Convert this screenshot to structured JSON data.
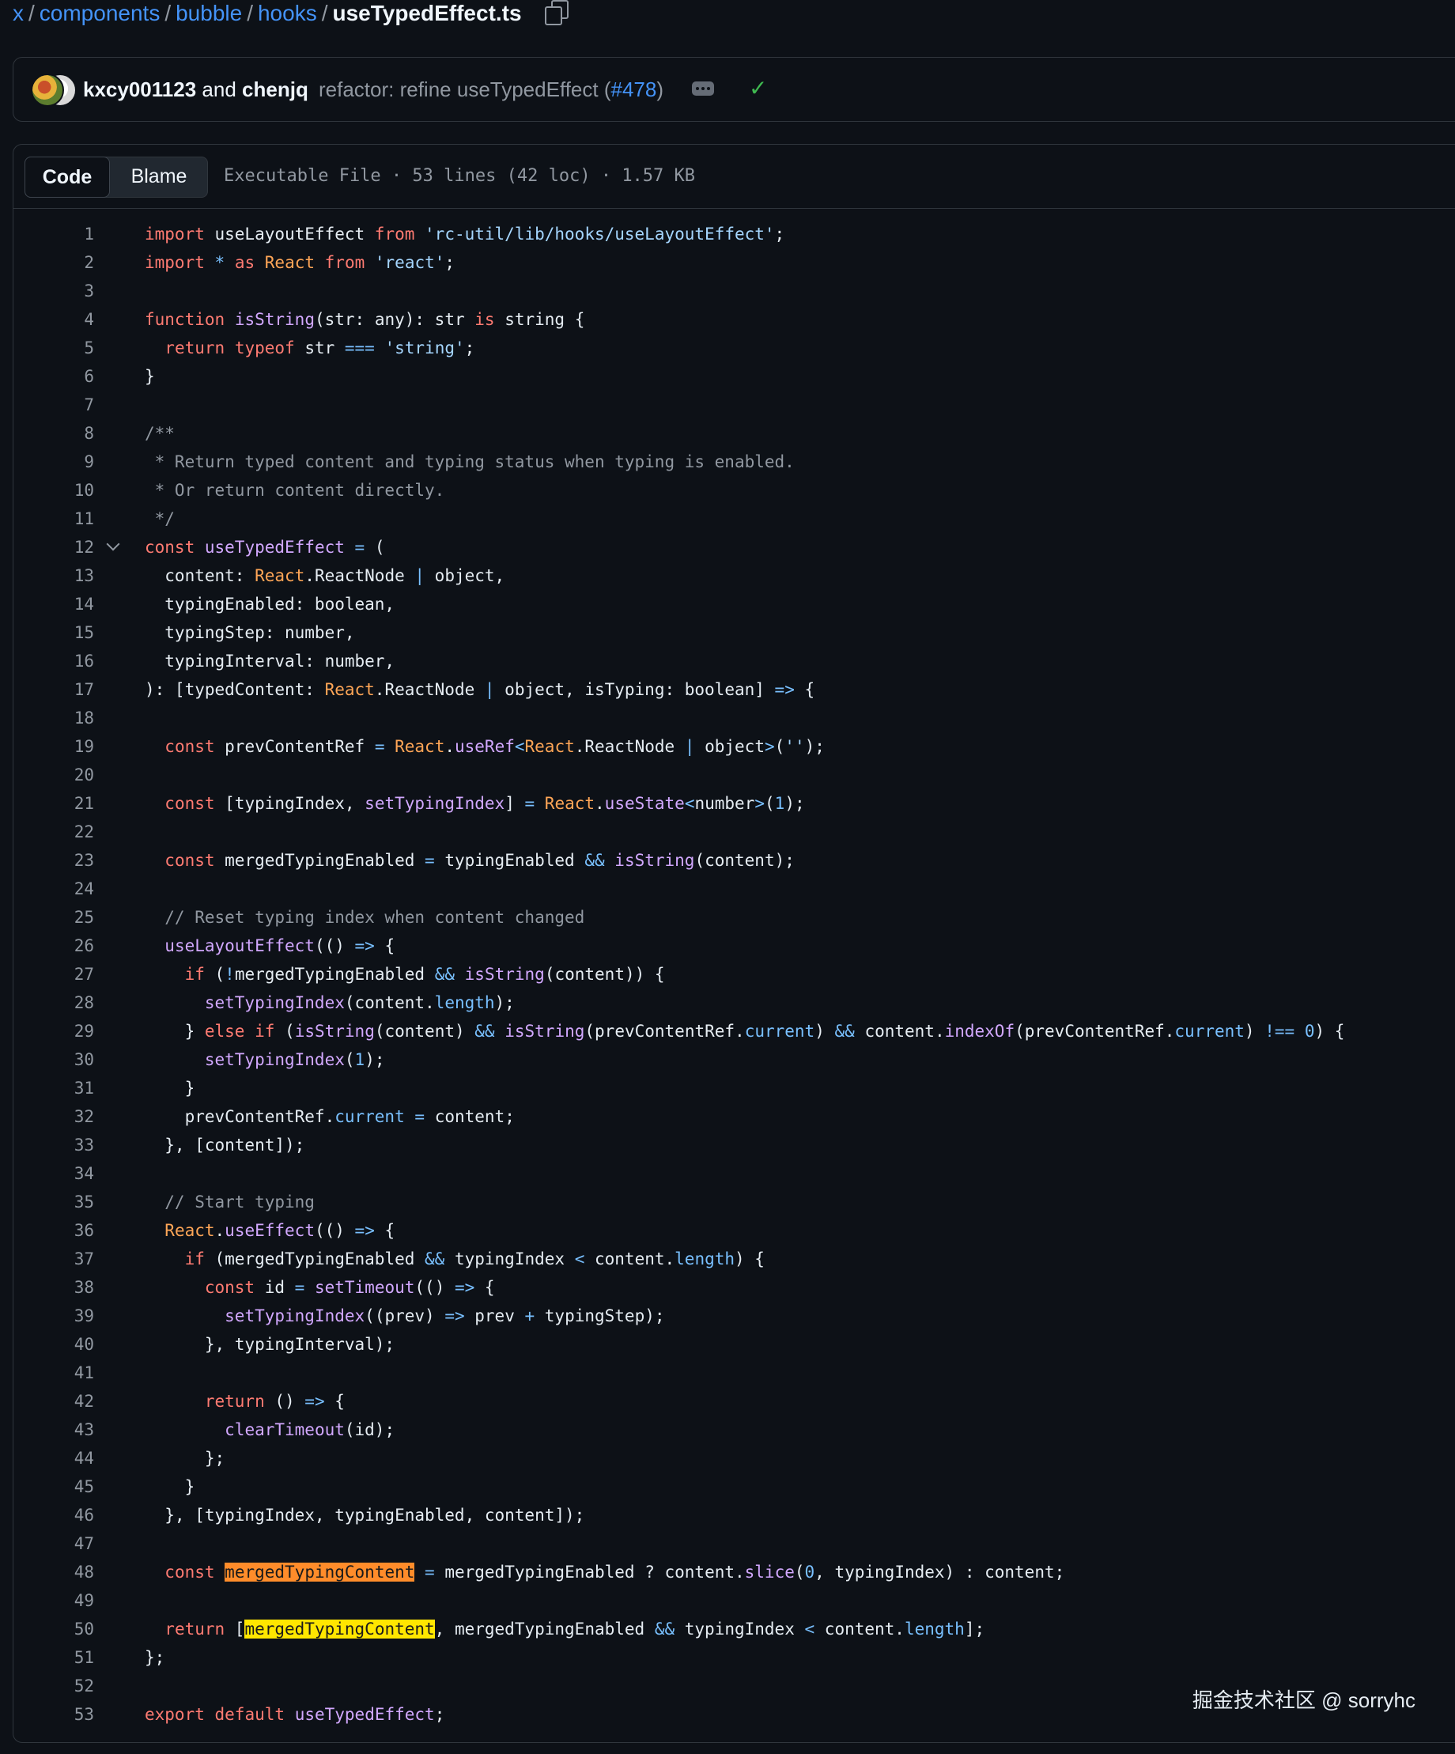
{
  "breadcrumb": {
    "parts": [
      "x",
      "components",
      "bubble",
      "hooks"
    ],
    "current": "useTypedEffect.ts",
    "separator": "/"
  },
  "commit": {
    "author1": "kxcy001123",
    "and": "and",
    "author2": "chenjq",
    "message": "refactor: refine useTypedEffect (",
    "pr": "#478",
    "message_end": ")",
    "status_icon": "check-icon"
  },
  "file": {
    "tabs": {
      "code": "Code",
      "blame": "Blame"
    },
    "meta": "Executable File · 53 lines (42 loc) · 1.57 KB"
  },
  "colors": {
    "keyword": "#ff7b72",
    "string": "#a5d6ff",
    "function": "#d2a8ff",
    "comment": "#9198a1",
    "constant": "#79c0ff",
    "variable": "#ffa657",
    "highlight_orange": "#ff8c2a",
    "highlight_yellow": "#ffe600"
  },
  "code": [
    {
      "n": "1",
      "t": [
        [
          "k",
          "import"
        ],
        [
          "",
          "useLayoutEffect"
        ],
        [
          "k",
          "from"
        ],
        [
          "s",
          "'rc-util/lib/hooks/useLayoutEffect'"
        ],
        [
          "",
          ";"
        ]
      ],
      "raw": "import useLayoutEffect from 'rc-util/lib/hooks/useLayoutEffect';"
    },
    {
      "n": "2",
      "raw": "import * as React from 'react';",
      "t": [
        [
          "k",
          "import"
        ],
        [
          "n",
          "*"
        ],
        [
          "k",
          "as"
        ],
        [
          "v",
          "React"
        ],
        [
          "k",
          "from"
        ],
        [
          "s",
          "'react'"
        ],
        [
          "",
          ";"
        ]
      ]
    },
    {
      "n": "3",
      "raw": ""
    },
    {
      "n": "4",
      "raw": "function isString(str: any): str is string {"
    },
    {
      "n": "5",
      "raw": "  return typeof str === 'string';"
    },
    {
      "n": "6",
      "raw": "}"
    },
    {
      "n": "7",
      "raw": ""
    },
    {
      "n": "8",
      "raw": "/**"
    },
    {
      "n": "9",
      "raw": " * Return typed content and typing status when typing is enabled."
    },
    {
      "n": "10",
      "raw": " * Or return content directly."
    },
    {
      "n": "11",
      "raw": " */"
    },
    {
      "n": "12",
      "raw": "const useTypedEffect = ("
    },
    {
      "n": "13",
      "raw": "  content: React.ReactNode | object,"
    },
    {
      "n": "14",
      "raw": "  typingEnabled: boolean,"
    },
    {
      "n": "15",
      "raw": "  typingStep: number,"
    },
    {
      "n": "16",
      "raw": "  typingInterval: number,"
    },
    {
      "n": "17",
      "raw": "): [typedContent: React.ReactNode | object, isTyping: boolean] => {"
    },
    {
      "n": "18",
      "raw": ""
    },
    {
      "n": "19",
      "raw": "  const prevContentRef = React.useRef<React.ReactNode | object>('');"
    },
    {
      "n": "20",
      "raw": ""
    },
    {
      "n": "21",
      "raw": "  const [typingIndex, setTypingIndex] = React.useState<number>(1);"
    },
    {
      "n": "22",
      "raw": ""
    },
    {
      "n": "23",
      "raw": "  const mergedTypingEnabled = typingEnabled && isString(content);"
    },
    {
      "n": "24",
      "raw": ""
    },
    {
      "n": "25",
      "raw": "  // Reset typing index when content changed"
    },
    {
      "n": "26",
      "raw": "  useLayoutEffect(() => {"
    },
    {
      "n": "27",
      "raw": "    if (!mergedTypingEnabled && isString(content)) {"
    },
    {
      "n": "28",
      "raw": "      setTypingIndex(content.length);"
    },
    {
      "n": "29",
      "raw": "    } else if (isString(content) && isString(prevContentRef.current) && content.indexOf(prevContentRef.current) !== 0) {"
    },
    {
      "n": "30",
      "raw": "      setTypingIndex(1);"
    },
    {
      "n": "31",
      "raw": "    }"
    },
    {
      "n": "32",
      "raw": "    prevContentRef.current = content;"
    },
    {
      "n": "33",
      "raw": "  }, [content]);"
    },
    {
      "n": "34",
      "raw": ""
    },
    {
      "n": "35",
      "raw": "  // Start typing"
    },
    {
      "n": "36",
      "raw": "  React.useEffect(() => {"
    },
    {
      "n": "37",
      "raw": "    if (mergedTypingEnabled && typingIndex < content.length) {"
    },
    {
      "n": "38",
      "raw": "      const id = setTimeout(() => {"
    },
    {
      "n": "39",
      "raw": "        setTypingIndex((prev) => prev + typingStep);"
    },
    {
      "n": "40",
      "raw": "      }, typingInterval);"
    },
    {
      "n": "41",
      "raw": ""
    },
    {
      "n": "42",
      "raw": "      return () => {"
    },
    {
      "n": "43",
      "raw": "        clearTimeout(id);"
    },
    {
      "n": "44",
      "raw": "      };"
    },
    {
      "n": "45",
      "raw": "    }"
    },
    {
      "n": "46",
      "raw": "  }, [typingIndex, typingEnabled, content]);"
    },
    {
      "n": "47",
      "raw": ""
    },
    {
      "n": "48",
      "raw": "  const mergedTypingContent = mergedTypingEnabled ? content.slice(0, typingIndex) : content;"
    },
    {
      "n": "49",
      "raw": ""
    },
    {
      "n": "50",
      "raw": "  return [mergedTypingContent, mergedTypingEnabled && typingIndex < content.length];"
    },
    {
      "n": "51",
      "raw": "};"
    },
    {
      "n": "52",
      "raw": ""
    },
    {
      "n": "53",
      "raw": "export default useTypedEffect;"
    }
  ],
  "watermark": "掘金技术社区 @ sorryhc"
}
